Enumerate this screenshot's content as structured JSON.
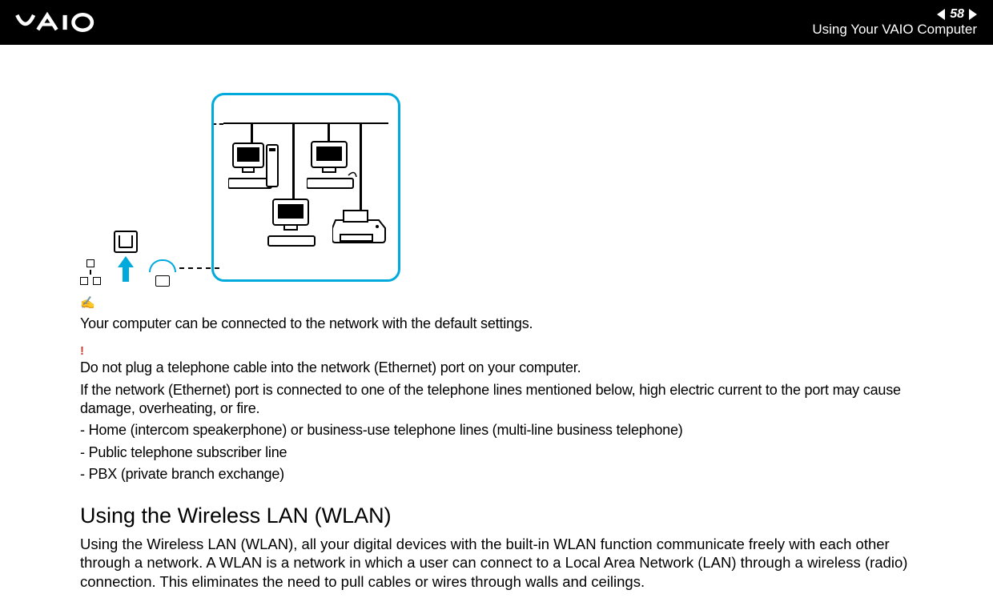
{
  "header": {
    "page_number": "58",
    "chapter": "Using Your VAIO Computer",
    "nav_prev": "Previous page",
    "nav_next": "Next page",
    "logo_alt": "VAIO"
  },
  "notes": {
    "note_icon": "✍",
    "note_text": "Your computer can be connected to the network with the default settings.",
    "warn_icon": "!",
    "warn_line1": "Do not plug a telephone cable into the network (Ethernet) port on your computer.",
    "warn_line2": "If the network (Ethernet) port is connected to one of the telephone lines mentioned below, high electric current to the port may cause damage, overheating, or fire.",
    "bullets": [
      "- Home (intercom speakerphone) or business-use telephone lines (multi-line business telephone)",
      "- Public telephone subscriber line",
      "- PBX (private branch exchange)"
    ]
  },
  "section": {
    "heading": "Using the Wireless LAN (WLAN)",
    "paragraph": "Using the Wireless LAN (WLAN), all your digital devices with the built-in WLAN function communicate freely with each other through a network. A WLAN is a network in which a user can connect to a Local Area Network (LAN) through a wireless (radio) connection. This eliminates the need to pull cables or wires through walls and ceilings."
  },
  "diagram": {
    "ethernet_port": "Ethernet port",
    "network_hub": "Network hub",
    "ethernet_cable": "Ethernet cable",
    "network_box": "Local area network example"
  }
}
